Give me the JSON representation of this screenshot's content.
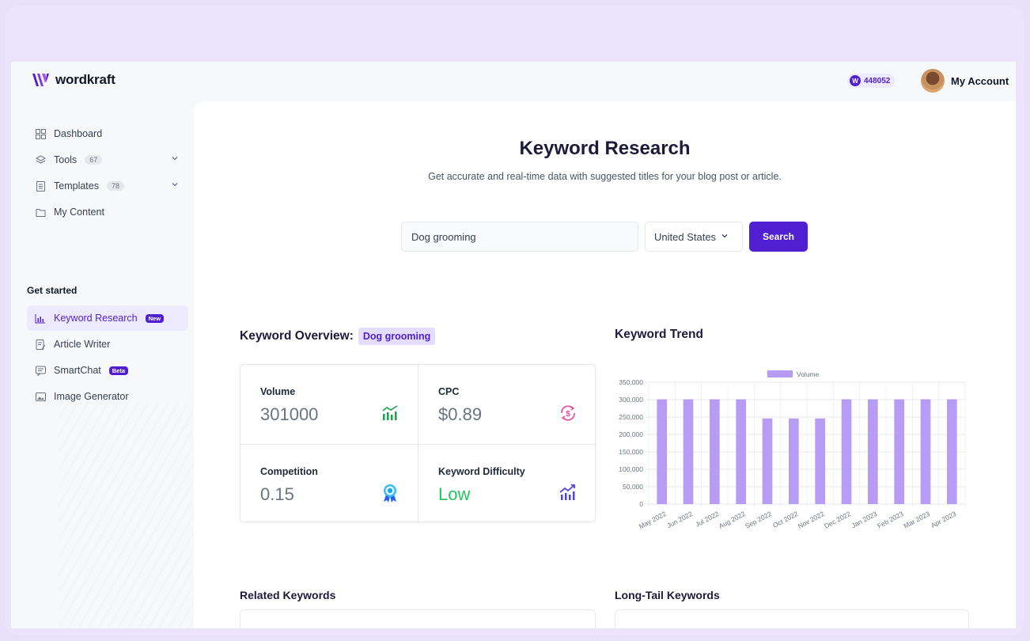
{
  "brand": {
    "name": "wordkraft"
  },
  "header": {
    "credits_icon": "W",
    "credits": "448052",
    "account_label": "My Account"
  },
  "sidebar": {
    "items": [
      {
        "label": "Dashboard",
        "icon": "grid-icon"
      },
      {
        "label": "Tools",
        "count": "67",
        "icon": "layers-icon"
      },
      {
        "label": "Templates",
        "count": "78",
        "icon": "document-icon"
      },
      {
        "label": "My Content",
        "icon": "folder-icon"
      }
    ],
    "section_label": "Get started",
    "started": [
      {
        "label": "Keyword Research",
        "badge": "New",
        "icon": "chart-icon"
      },
      {
        "label": "Article Writer",
        "icon": "pen-doc-icon"
      },
      {
        "label": "SmartChat",
        "badge": "Beta",
        "icon": "chat-icon"
      },
      {
        "label": "Image Generator",
        "icon": "image-icon"
      }
    ]
  },
  "main": {
    "title": "Keyword Research",
    "subtitle": "Get accurate and real-time data with suggested titles for your blog post or article.",
    "search_value": "Dog grooming",
    "country": "United States",
    "search_button": "Search",
    "overview_label": "Keyword Overview:",
    "overview_keyword": "Dog grooming",
    "trend_label": "Keyword Trend",
    "metrics": {
      "volume": {
        "label": "Volume",
        "value": "301000"
      },
      "cpc": {
        "label": "CPC",
        "value": "$0.89"
      },
      "competition": {
        "label": "Competition",
        "value": "0.15"
      },
      "difficulty": {
        "label": "Keyword Difficulty",
        "value": "Low"
      }
    },
    "related_title": "Related Keywords",
    "longtail_title": "Long-Tail Keywords"
  },
  "colors": {
    "accent": "#4f1fd1",
    "bar": "#b79cf6",
    "low": "#22c55e"
  },
  "chart_data": {
    "type": "bar",
    "legend": "Volume",
    "legend_position": "top",
    "categories": [
      "May 2022",
      "Jun 2022",
      "Jul 2022",
      "Aug 2022",
      "Sep 2022",
      "Oct 2022",
      "Nov 2022",
      "Dec 2022",
      "Jan 2023",
      "Feb 2023",
      "Mar 2023",
      "Apr 2023"
    ],
    "series": [
      {
        "name": "Volume",
        "values": [
          301000,
          301000,
          301000,
          301000,
          246000,
          246000,
          246000,
          301000,
          301000,
          301000,
          301000,
          301000
        ]
      }
    ],
    "ylim": [
      0,
      350000
    ],
    "yticks": [
      "0",
      "50,000",
      "100,000",
      "150,000",
      "200,000",
      "250,000",
      "300,000",
      "350,000"
    ],
    "grid": true
  }
}
